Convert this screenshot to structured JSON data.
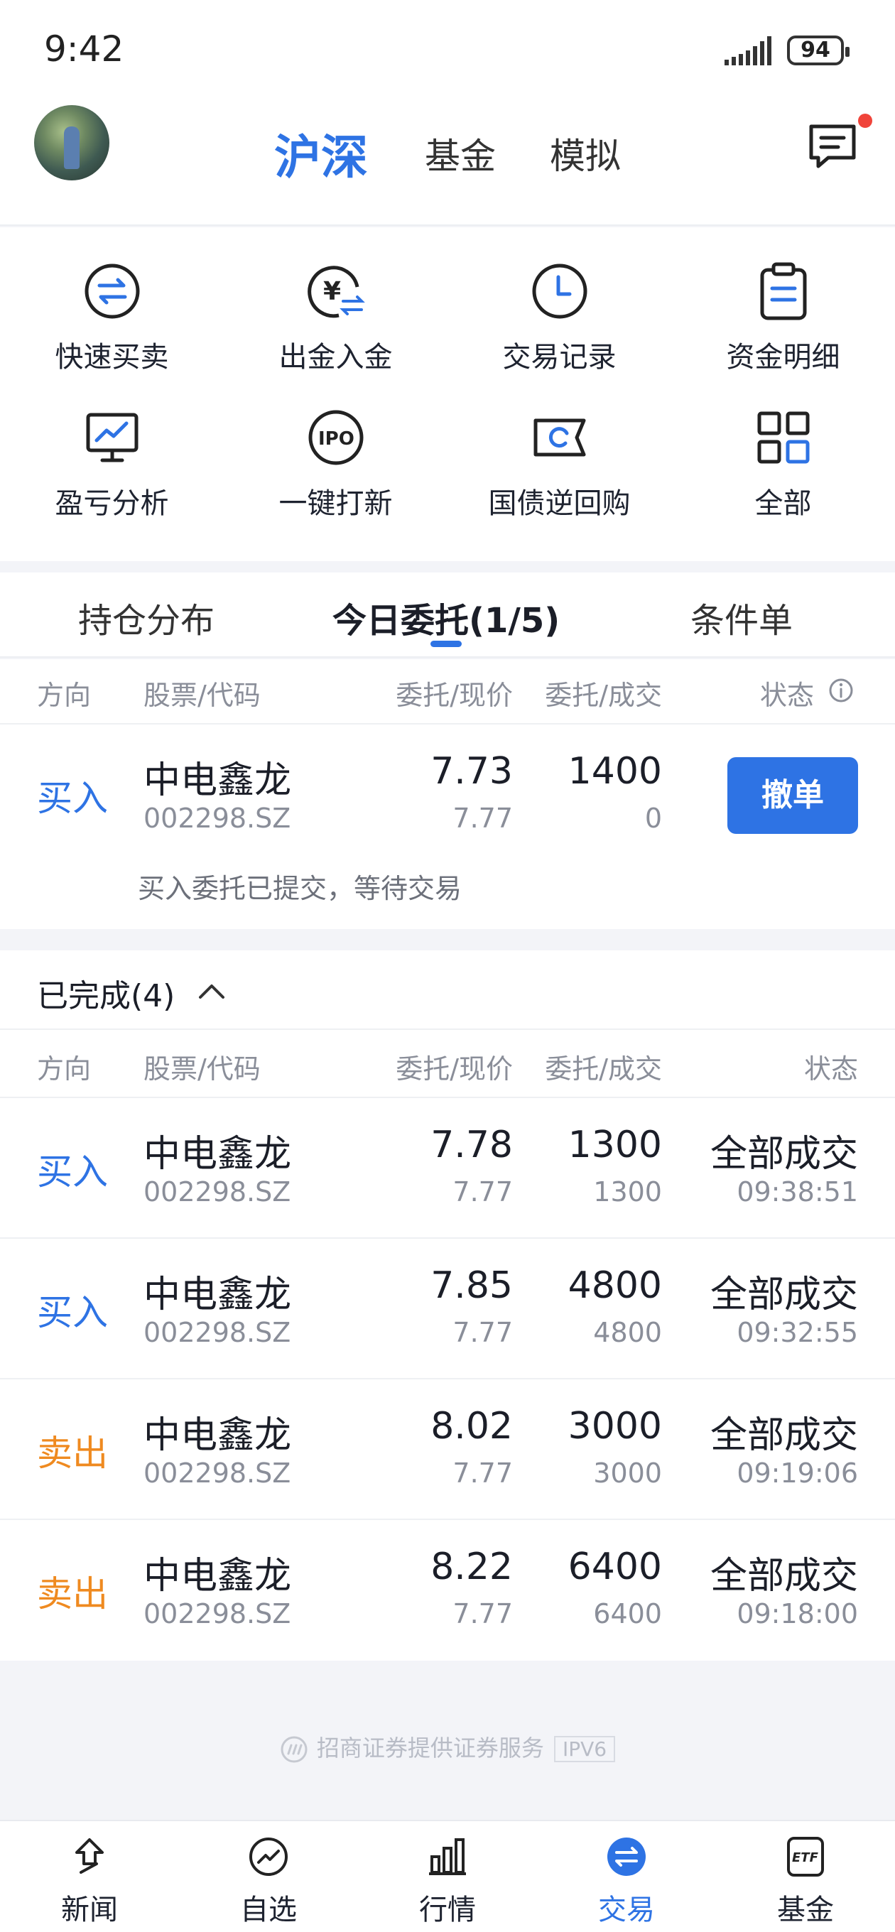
{
  "status_bar": {
    "time": "9:42",
    "battery": "94"
  },
  "header": {
    "tabs": [
      {
        "label": "沪深",
        "active": true
      },
      {
        "label": "基金",
        "active": false
      },
      {
        "label": "模拟",
        "active": false
      }
    ],
    "message_icon": "message-icon"
  },
  "quick_actions": [
    {
      "label": "快速买卖",
      "icon": "swap-icon"
    },
    {
      "label": "出金入金",
      "icon": "yuan-transfer-icon"
    },
    {
      "label": "交易记录",
      "icon": "clock-icon"
    },
    {
      "label": "资金明细",
      "icon": "clipboard-icon"
    },
    {
      "label": "盈亏分析",
      "icon": "monitor-chart-icon"
    },
    {
      "label": "一键打新",
      "icon": "ipo-icon"
    },
    {
      "label": "国债逆回购",
      "icon": "repo-ticket-icon"
    },
    {
      "label": "全部",
      "icon": "grid-icon"
    }
  ],
  "tabs": [
    {
      "label": "持仓分布",
      "active": false
    },
    {
      "label": "今日委托(1/5)",
      "active": true
    },
    {
      "label": "条件单",
      "active": false
    }
  ],
  "columns": {
    "direction": "方向",
    "stock": "股票/代码",
    "price": "委托/现价",
    "qty": "委托/成交",
    "status": "状态"
  },
  "pending": {
    "direction": "买入",
    "name": "中电鑫龙",
    "code": "002298.SZ",
    "order_price": "7.73",
    "current_price": "7.77",
    "order_qty": "1400",
    "filled_qty": "0",
    "cancel_label": "撤单",
    "note": "买入委托已提交，等待交易"
  },
  "completed": {
    "title": "已完成(4)",
    "rows": [
      {
        "direction": "买入",
        "side": "buy",
        "name": "中电鑫龙",
        "code": "002298.SZ",
        "order_price": "7.78",
        "current_price": "7.77",
        "order_qty": "1300",
        "filled_qty": "1300",
        "status": "全部成交",
        "time": "09:38:51"
      },
      {
        "direction": "买入",
        "side": "buy",
        "name": "中电鑫龙",
        "code": "002298.SZ",
        "order_price": "7.85",
        "current_price": "7.77",
        "order_qty": "4800",
        "filled_qty": "4800",
        "status": "全部成交",
        "time": "09:32:55"
      },
      {
        "direction": "卖出",
        "side": "sell",
        "name": "中电鑫龙",
        "code": "002298.SZ",
        "order_price": "8.02",
        "current_price": "7.77",
        "order_qty": "3000",
        "filled_qty": "3000",
        "status": "全部成交",
        "time": "09:19:06"
      },
      {
        "direction": "卖出",
        "side": "sell",
        "name": "中电鑫龙",
        "code": "002298.SZ",
        "order_price": "8.22",
        "current_price": "7.77",
        "order_qty": "6400",
        "filled_qty": "6400",
        "status": "全部成交",
        "time": "09:18:00"
      }
    ]
  },
  "footer": {
    "text": "招商证券提供证券服务",
    "badge": "IPV6"
  },
  "bottom_nav": [
    {
      "label": "新闻",
      "icon": "news-icon",
      "active": false
    },
    {
      "label": "自选",
      "icon": "watchlist-icon",
      "active": false
    },
    {
      "label": "行情",
      "icon": "market-icon",
      "active": false
    },
    {
      "label": "交易",
      "icon": "trade-icon",
      "active": true
    },
    {
      "label": "基金",
      "icon": "etf-icon",
      "active": false
    }
  ],
  "colors": {
    "accent": "#2e73e4",
    "buy": "#2e73e4",
    "sell": "#ef8a20",
    "badge": "#f0443a"
  }
}
